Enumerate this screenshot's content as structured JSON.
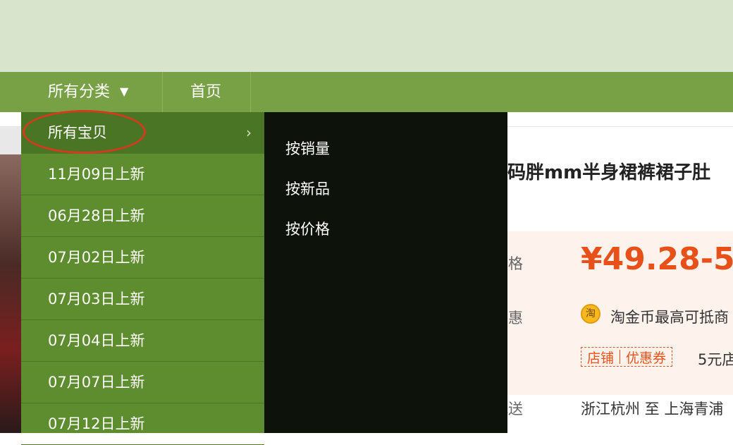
{
  "nav": {
    "all_categories": "所有分类",
    "dropdown_icon": "▼",
    "home": "首页"
  },
  "menu": {
    "items": [
      {
        "label": "所有宝贝",
        "active": true,
        "arrow": "›"
      },
      {
        "label": "11月09日上新"
      },
      {
        "label": "06月28日上新"
      },
      {
        "label": "07月02日上新"
      },
      {
        "label": "07月03日上新"
      },
      {
        "label": "07月04日上新"
      },
      {
        "label": "07月07日上新"
      },
      {
        "label": "07月12日上新"
      }
    ]
  },
  "submenu": {
    "items": [
      "按销量",
      "按新品",
      "按价格"
    ]
  },
  "product": {
    "title": "码胖mm半身裙裤裙子肚",
    "price_label": "价格",
    "price": "¥49.28-5",
    "promo_label": "优惠",
    "coin_icon": "淘",
    "promo_text": "淘金币最高可抵商",
    "coupon_store": "店铺",
    "coupon_label": "优惠券",
    "coupon_text": "5元店",
    "ship_label": "配送",
    "ship_text": "浙江杭州 至 上海青浦"
  },
  "colors": {
    "banner": "#d9e4cc",
    "navbar": "#78a145",
    "menu": "#5e8d2f",
    "submenu": "#0d130a",
    "price": "#e8501a",
    "highlight_circle": "#d23b1e"
  }
}
